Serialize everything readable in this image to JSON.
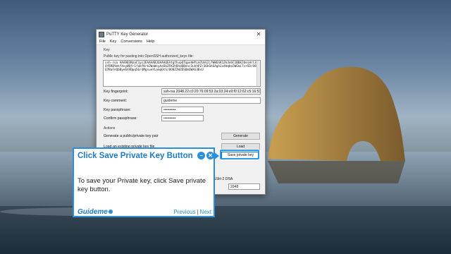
{
  "window": {
    "title": "PuTTY Key Generator",
    "close_glyph": "✕",
    "menu": [
      "File",
      "Key",
      "Conversions",
      "Help"
    ]
  },
  "key_section": {
    "group_label": "Key",
    "public_key_label": "Public key for pasting into OpenSSH authorized_keys file:",
    "public_key_text": "ssh-rsa AAAAB3NzaC1yc2EAAAABJQAAAQEAtgfhvpQTqpehHYLm7UnG2j7WWGSK12k3oGC1BBk2UeiHrl3/4YRRBYmkfXeyWQfr1fakfKrb2WaWcyAaSbZPX2h8hdQBenc3uhhPZr36kGhGAgAJx4bqbo5WGmi7s+5D/O87Q7BaFnQbBye6XVDpq5G/4MgsueYLamqGtS/8O8Z2W2DSDmOWXG3BsU"
  },
  "fields": {
    "fingerprint_label": "Key fingerprint:",
    "fingerprint_value": "ssh-rsa 2048 22:c0:20:76:09:53:2a:03:24:e9:f0:12:62:c5:16:53",
    "comment_label": "Key comment:",
    "comment_value": "guideme",
    "passphrase_label": "Key passphrase:",
    "passphrase_value": "••••••••••",
    "confirm_label": "Confirm passphrase:",
    "confirm_value": "••••••••••"
  },
  "actions": {
    "group_label": "Actions",
    "generate_label": "Generate a public/private key pair",
    "generate_button": "Generate",
    "load_label": "Load an existing private key file",
    "load_button": "Load",
    "save_button": "Save private key",
    "dsa_label": "SSH-2 DSA",
    "bits_value": "2048"
  },
  "tooltip": {
    "title": "Click Save Private Key Button",
    "body": "To save your Private key, click Save private key button.",
    "logo": "Guideme",
    "minimize_glyph": "−",
    "close_glyph": "✕",
    "previous": "Previous",
    "separator": "|",
    "next": "Next"
  },
  "colors": {
    "accent": "#2b8fd9",
    "title_text": "#1f7ac8"
  }
}
